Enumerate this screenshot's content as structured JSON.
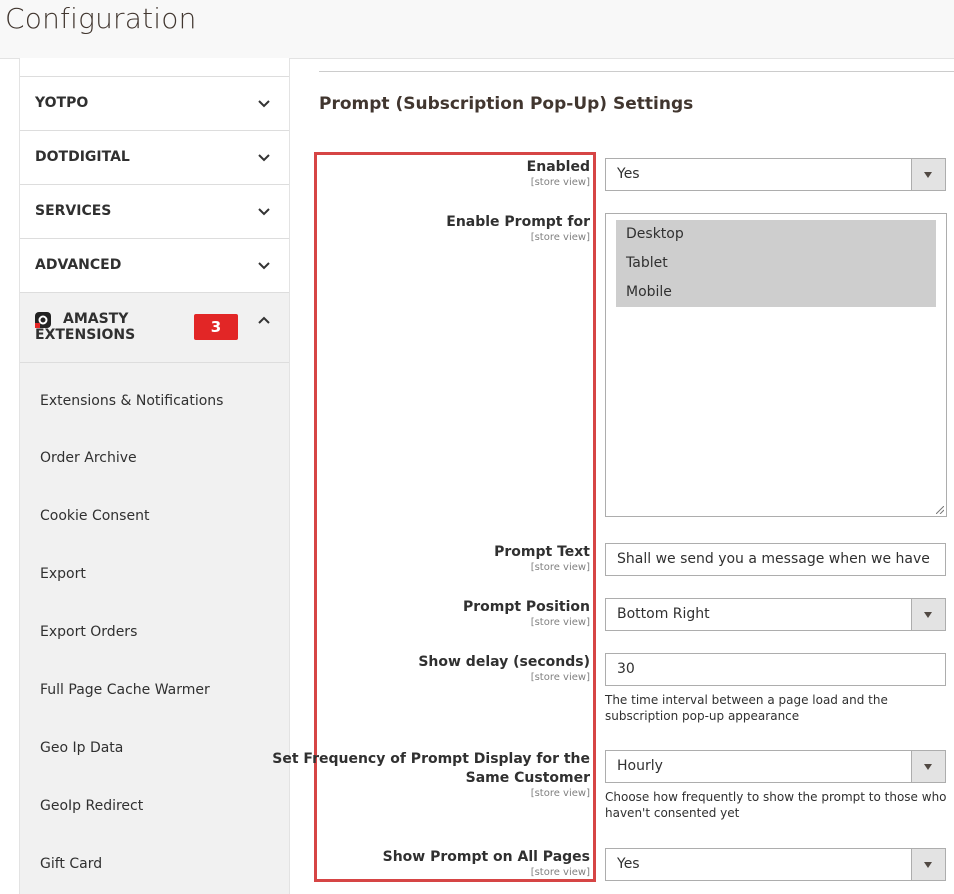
{
  "header": {
    "title": "Configuration"
  },
  "sidebar": {
    "sections": [
      {
        "label": "YOTPO"
      },
      {
        "label": "DOTDIGITAL"
      },
      {
        "label": "SERVICES"
      },
      {
        "label": "ADVANCED"
      }
    ],
    "amasty": {
      "label_line1": "AMASTY",
      "label_line2": "EXTENSIONS",
      "badge": "3",
      "items": [
        "Extensions & Notifications",
        "Order Archive",
        "Cookie Consent",
        "Export",
        "Export Orders",
        "Full Page Cache Warmer",
        "Geo Ip Data",
        "GeoIp Redirect",
        "Gift Card"
      ]
    }
  },
  "main": {
    "section_title": "Prompt (Subscription Pop-Up) Settings",
    "scope_label": "[store view]",
    "fields": {
      "enabled": {
        "label": "Enabled",
        "value": "Yes"
      },
      "enable_prompt_for": {
        "label": "Enable Prompt for",
        "options": [
          "Desktop",
          "Tablet",
          "Mobile"
        ]
      },
      "prompt_text": {
        "label": "Prompt Text",
        "value": "Shall we send you a message when we have discounts"
      },
      "prompt_position": {
        "label": "Prompt Position",
        "value": "Bottom Right"
      },
      "show_delay": {
        "label": "Show delay (seconds)",
        "value": "30",
        "note": "The time interval between a page load and the subscription pop-up appearance"
      },
      "frequency": {
        "label_line1": "Set Frequency of Prompt Display for the",
        "label_line2": "Same Customer",
        "value": "Hourly",
        "note": "Choose how frequently to show the prompt to those who haven't consented yet"
      },
      "all_pages": {
        "label": "Show Prompt on All Pages",
        "value": "Yes"
      }
    }
  },
  "colors": {
    "highlight": "#d64545",
    "badge": "#e22626",
    "selected_option": "#cecece"
  }
}
